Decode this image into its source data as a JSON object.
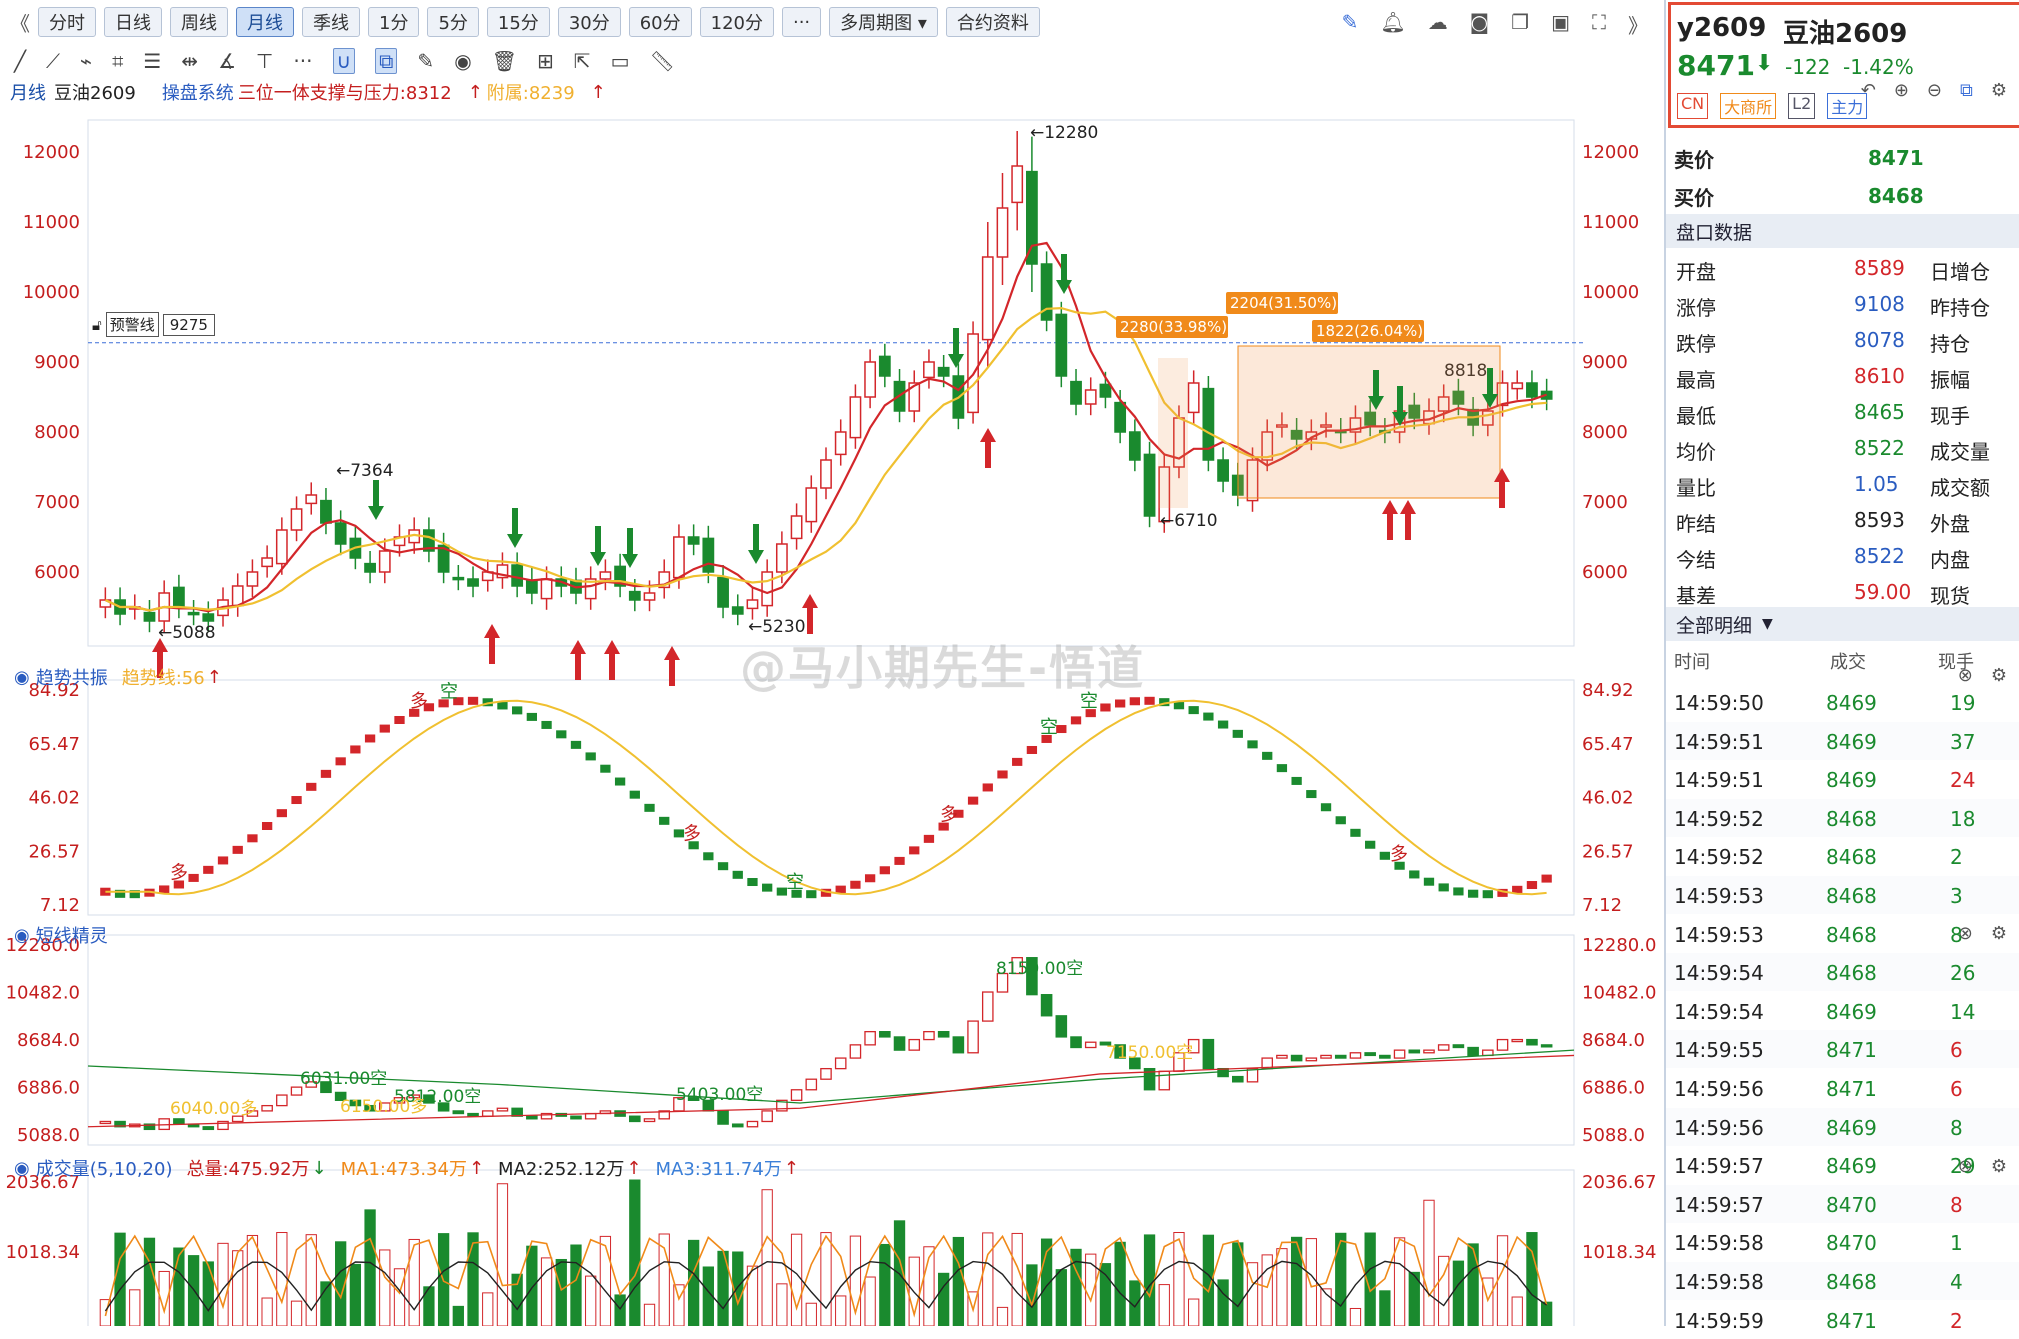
{
  "toolbar": {
    "periods": [
      "分时",
      "日线",
      "周线",
      "月线",
      "季线",
      "1分",
      "5分",
      "15分",
      "30分",
      "60分",
      "120分",
      "···"
    ],
    "active_period": "月线",
    "multi_period": "多周期图 ▾",
    "contract_info": "合约资料"
  },
  "info": {
    "period": "月线",
    "symbol": "豆油2609",
    "system_label": "操盘系统",
    "indicator": "三位一体支撑与压力:8312",
    "arrow1": "↑",
    "attached": "附属:8239",
    "arrow2": "↑"
  },
  "alert": {
    "label": "预警线",
    "value": "9275"
  },
  "main_chart": {
    "y_ticks": [
      "12000",
      "11000",
      "10000",
      "9000",
      "8000",
      "7000",
      "6000"
    ],
    "labels": {
      "high": "←12280",
      "low1": "←5088",
      "peak1": "←7364",
      "low2": "←5230",
      "low3": "←6710",
      "val8818": "8818"
    },
    "boxes": [
      "2280(33.98%)",
      "2204(31.50%)",
      "1822(26.04%)"
    ]
  },
  "panel1": {
    "title": "趋势共振",
    "sub": "趋势线:56",
    "arrow": "↑",
    "y_ticks": [
      "84.92",
      "65.47",
      "46.02",
      "26.57",
      "7.12"
    ],
    "marks": [
      "多",
      "多",
      "空",
      "多",
      "空",
      "多",
      "空",
      "空",
      "多"
    ]
  },
  "panel2": {
    "title": "短线精灵",
    "y_ticks": [
      "12280.0",
      "10482.0",
      "8684.0",
      "6886.0",
      "5088.0"
    ],
    "labels": [
      "8150.00空",
      "6031.00空",
      "5812.00空",
      "6040.00多",
      "6150.00多",
      "5403.00空",
      "7150.00空"
    ]
  },
  "panel3": {
    "title": "成交量(5,10,20)",
    "total": "总量:475.92万",
    "arrow1": "↓",
    "ma1": "MA1:473.34万",
    "arrow2": "↑",
    "ma2": "MA2:252.12万",
    "arrow3": "↑",
    "ma3": "MA3:311.74万",
    "arrow4": "↑",
    "y_ticks": [
      "2036.67",
      "1018.34"
    ]
  },
  "watermark": "@马小期先生-悟道",
  "quote": {
    "code": "y2609",
    "name": "豆油2609",
    "price": "8471",
    "arrow": "⬇",
    "change": "-122",
    "pct": "-1.42%",
    "tags": [
      "CN",
      "大商所",
      "L2",
      "主力"
    ],
    "sell_label": "卖价",
    "sell": "8471",
    "buy_label": "买价",
    "buy": "8468",
    "section": "盘口数据",
    "rows": [
      {
        "k": "开盘",
        "v": "8589",
        "k2": "日增仓",
        "c": "red"
      },
      {
        "k": "涨停",
        "v": "9108",
        "k2": "昨持仓",
        "c": "blue"
      },
      {
        "k": "跌停",
        "v": "8078",
        "k2": "持仓",
        "c": "blue"
      },
      {
        "k": "最高",
        "v": "8610",
        "k2": "振幅",
        "c": "red"
      },
      {
        "k": "最低",
        "v": "8465",
        "k2": "现手",
        "c": "green"
      },
      {
        "k": "均价",
        "v": "8522",
        "k2": "成交量",
        "c": "green"
      },
      {
        "k": "量比",
        "v": "1.05",
        "k2": "成交额",
        "c": "blue"
      },
      {
        "k": "昨结",
        "v": "8593",
        "k2": "外盘",
        "c": "black"
      },
      {
        "k": "今结",
        "v": "8522",
        "k2": "内盘",
        "c": "blue"
      },
      {
        "k": "基差",
        "v": "59.00",
        "k2": "现货",
        "c": "red"
      }
    ],
    "detail_section": "全部明细",
    "detail_headers": [
      "时间",
      "成交",
      "现手"
    ],
    "trades": [
      {
        "t": "14:59:50",
        "p": "8469",
        "q": "19",
        "c": "green"
      },
      {
        "t": "14:59:51",
        "p": "8469",
        "q": "37",
        "c": "green"
      },
      {
        "t": "14:59:51",
        "p": "8469",
        "q": "24",
        "c": "red"
      },
      {
        "t": "14:59:52",
        "p": "8468",
        "q": "18",
        "c": "green"
      },
      {
        "t": "14:59:52",
        "p": "8468",
        "q": "2",
        "c": "green"
      },
      {
        "t": "14:59:53",
        "p": "8468",
        "q": "3",
        "c": "green"
      },
      {
        "t": "14:59:53",
        "p": "8468",
        "q": "8",
        "c": "green"
      },
      {
        "t": "14:59:54",
        "p": "8468",
        "q": "26",
        "c": "green"
      },
      {
        "t": "14:59:54",
        "p": "8469",
        "q": "14",
        "c": "green"
      },
      {
        "t": "14:59:55",
        "p": "8471",
        "q": "6",
        "c": "red"
      },
      {
        "t": "14:59:56",
        "p": "8471",
        "q": "6",
        "c": "red"
      },
      {
        "t": "14:59:56",
        "p": "8469",
        "q": "8",
        "c": "green"
      },
      {
        "t": "14:59:57",
        "p": "8469",
        "q": "29",
        "c": "green"
      },
      {
        "t": "14:59:57",
        "p": "8470",
        "q": "8",
        "c": "red"
      },
      {
        "t": "14:59:58",
        "p": "8470",
        "q": "1",
        "c": "green"
      },
      {
        "t": "14:59:58",
        "p": "8468",
        "q": "4",
        "c": "green"
      },
      {
        "t": "14:59:59",
        "p": "8471",
        "q": "2",
        "c": "red"
      }
    ]
  },
  "chart_data": {
    "type": "candlestick",
    "title": "豆油2609 月线",
    "ylim": [
      5000,
      12500
    ],
    "y_ticks": [
      6000,
      7000,
      8000,
      9000,
      10000,
      11000,
      12000
    ],
    "highs_lows": {
      "max": 12280,
      "min": 5088,
      "local_high": 7364,
      "local_low": 5230,
      "recent_low": 6710,
      "recent_high": 8818
    },
    "closes": [
      5600,
      5400,
      5500,
      5300,
      5700,
      5500,
      5400,
      5300,
      5600,
      5800,
      6000,
      6200,
      6600,
      6900,
      7100,
      6700,
      6400,
      6200,
      6000,
      6300,
      6500,
      6600,
      6300,
      6000,
      5900,
      5800,
      6000,
      6100,
      5800,
      5700,
      5900,
      5800,
      5700,
      5900,
      6000,
      5800,
      5600,
      5700,
      6000,
      6500,
      6400,
      6000,
      5500,
      5400,
      5600,
      6000,
      6400,
      6800,
      7200,
      7600,
      8000,
      8500,
      9000,
      8800,
      8300,
      8700,
      9000,
      8800,
      8200,
      9400,
      10500,
      11200,
      11800,
      10400,
      9600,
      8800,
      8400,
      8600,
      8500,
      8000,
      7600,
      6800,
      7500,
      8200,
      8700,
      7600,
      7300,
      7100,
      7600,
      8000,
      8100,
      7900,
      8000,
      8100,
      8000,
      8200,
      8100,
      8000,
      8300,
      8200,
      8300,
      8500,
      8400,
      8100,
      8300,
      8700,
      8700,
      8500,
      8471
    ],
    "volume_ticks": [
      1018.34,
      2036.67
    ]
  }
}
